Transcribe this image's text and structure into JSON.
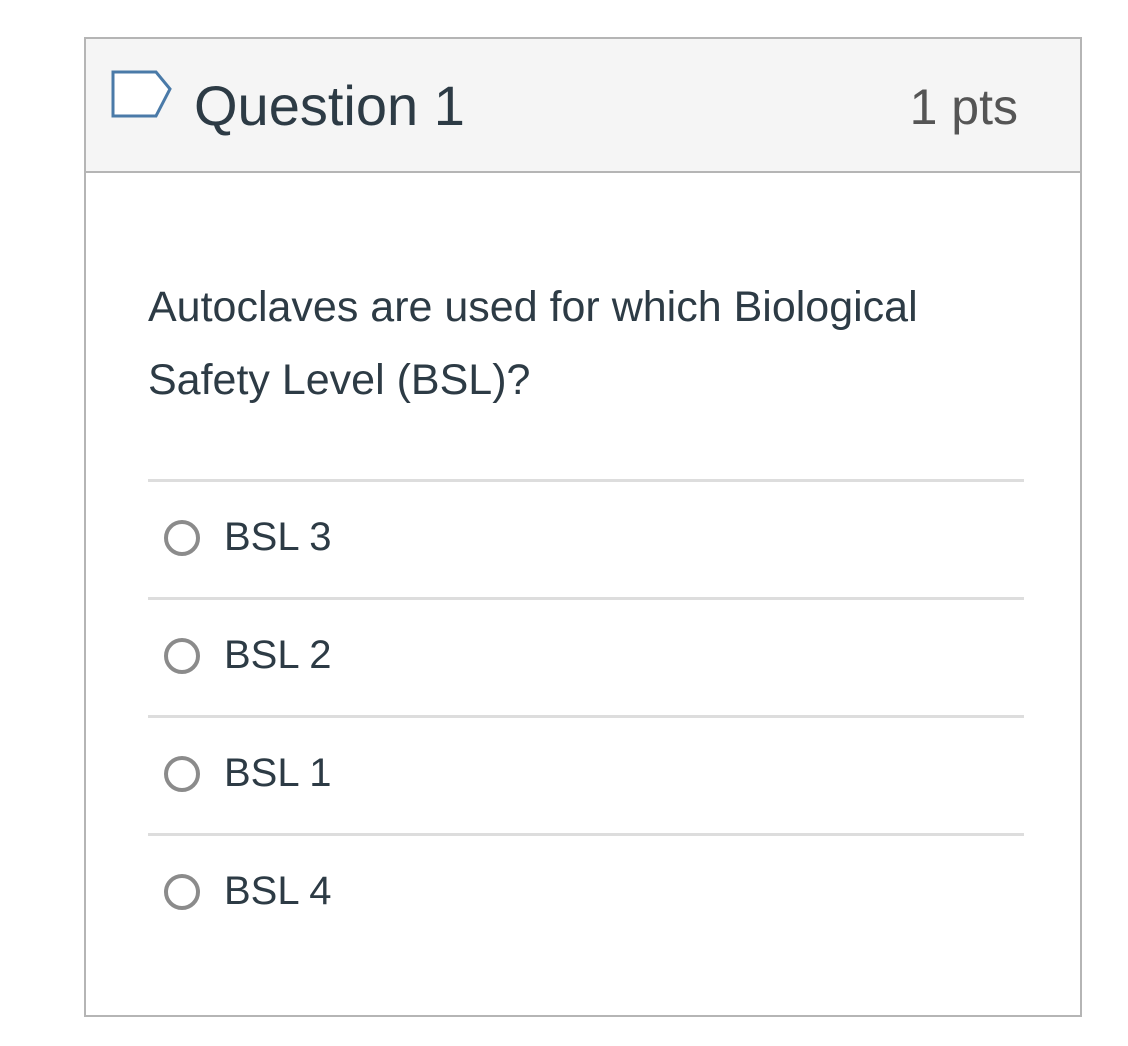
{
  "question": {
    "title": "Question 1",
    "points": "1 pts",
    "flag_icon": "flag-bookmark-icon",
    "text": "Autoclaves are used for which Biological Safety Level (BSL)?",
    "answers": [
      {
        "label": "BSL 3",
        "selected": false
      },
      {
        "label": "BSL 2",
        "selected": false
      },
      {
        "label": "BSL 1",
        "selected": false
      },
      {
        "label": "BSL 4",
        "selected": false
      }
    ]
  },
  "colors": {
    "border": "#b5b5b5",
    "header_bg": "#f5f5f5",
    "text": "#2d3b45",
    "flag_stroke": "#4a7aa8",
    "radio_border": "#8b8b8b"
  }
}
